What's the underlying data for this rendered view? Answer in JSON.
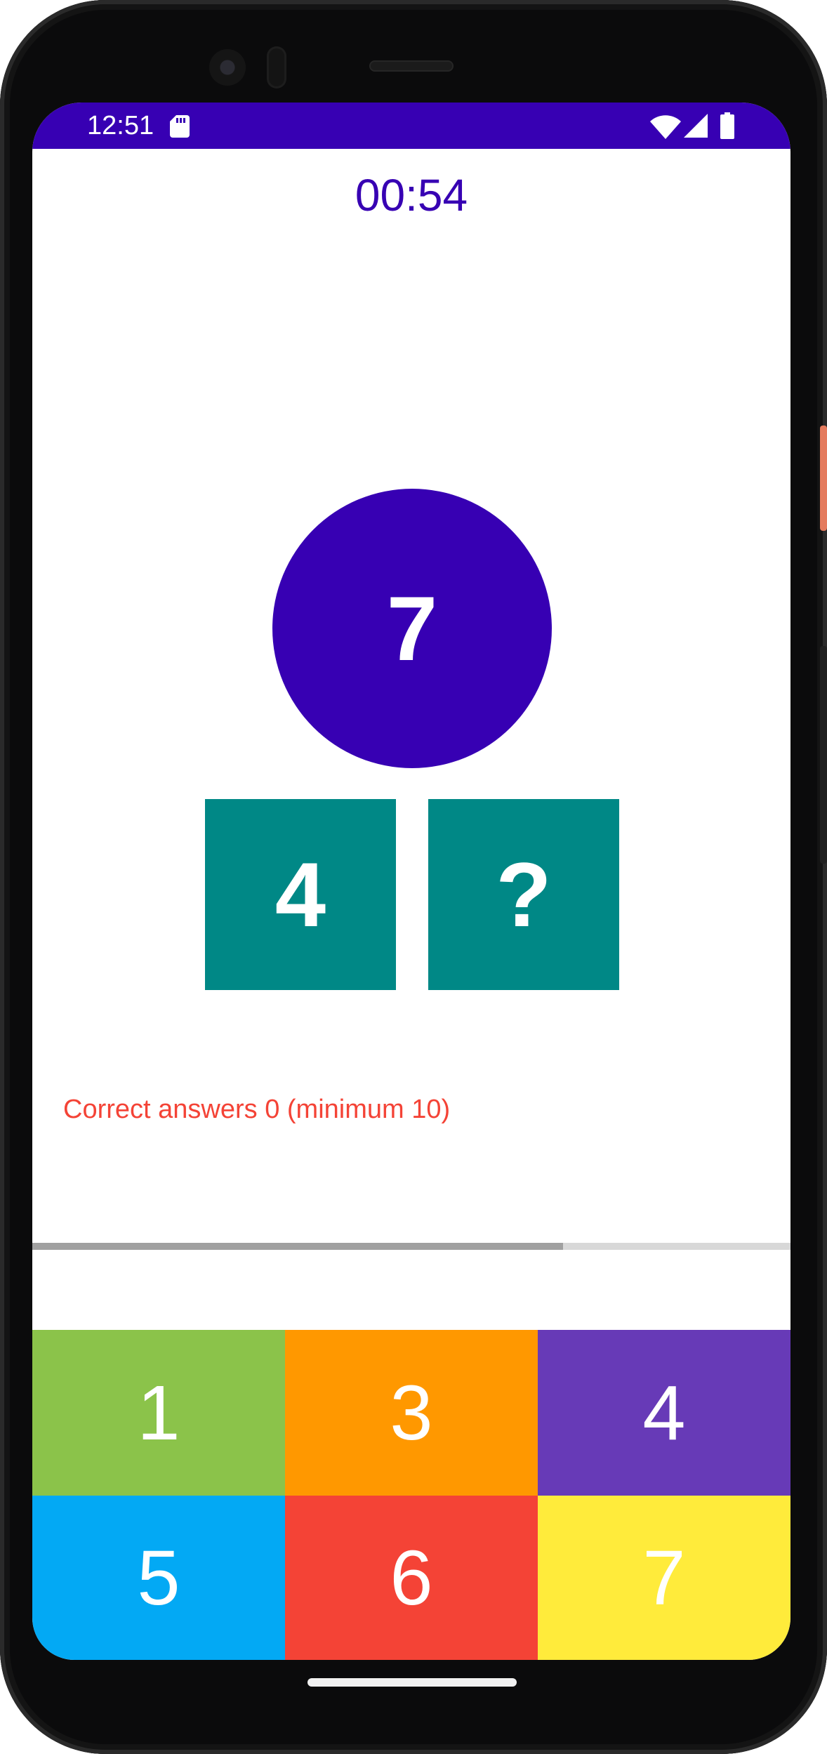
{
  "status_bar": {
    "time": "12:51",
    "bg_color": "#3700b3",
    "icons": [
      "sd-card-icon",
      "wifi-icon",
      "signal-icon",
      "battery-icon"
    ]
  },
  "game": {
    "timer": "00:54",
    "target_number": "7",
    "known_part": "4",
    "unknown_part": "?",
    "correct_answers_text": "Correct answers 0 (minimum 10)",
    "progress_fraction": 0.7
  },
  "keypad": {
    "keys": [
      {
        "label": "1",
        "color": "#8bc34a"
      },
      {
        "label": "3",
        "color": "#ff9800"
      },
      {
        "label": "4",
        "color": "#673ab7"
      },
      {
        "label": "5",
        "color": "#03a9f4"
      },
      {
        "label": "6",
        "color": "#f44336"
      },
      {
        "label": "7",
        "color": "#ffeb3b"
      }
    ]
  },
  "colors": {
    "accent": "#3700b3",
    "box": "#008886",
    "warning_text": "#f44336"
  }
}
